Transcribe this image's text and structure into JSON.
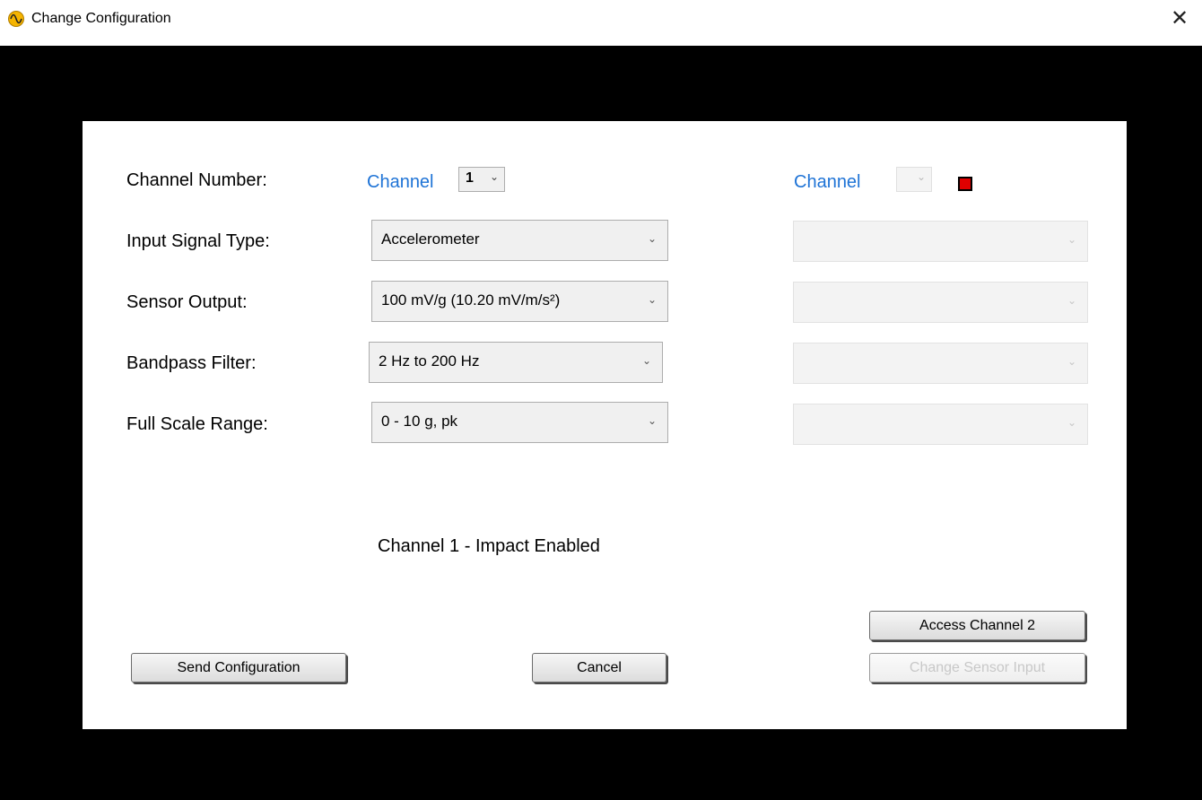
{
  "window": {
    "title": "Change Configuration"
  },
  "form": {
    "channel_number_label": "Channel Number:",
    "channel_word": "Channel",
    "channel_value": "1",
    "secondary_channel_word": "Channel",
    "secondary_channel_value": "",
    "rows": [
      {
        "label": "Input Signal Type:",
        "value": "Accelerometer",
        "secondary_value": ""
      },
      {
        "label": "Sensor Output:",
        "value": "100 mV/g (10.20 mV/m/s²)",
        "secondary_value": ""
      },
      {
        "label": "Bandpass Filter:",
        "value": "2 Hz to 200 Hz",
        "secondary_value": ""
      },
      {
        "label": "Full Scale Range:",
        "value": "0 - 10 g, pk",
        "secondary_value": ""
      }
    ],
    "status": "Channel 1 - Impact Enabled"
  },
  "buttons": {
    "access_channel_2": "Access Channel 2",
    "send_configuration": "Send Configuration",
    "cancel": "Cancel",
    "change_sensor_input": "Change Sensor Input"
  },
  "icons": {
    "app": "sine-wave-icon",
    "close": "close-icon",
    "dropdown": "chevron-down-icon"
  },
  "colors": {
    "channel_link": "#1e73d6",
    "indicator": "#e00000",
    "backdrop": "#000000"
  }
}
